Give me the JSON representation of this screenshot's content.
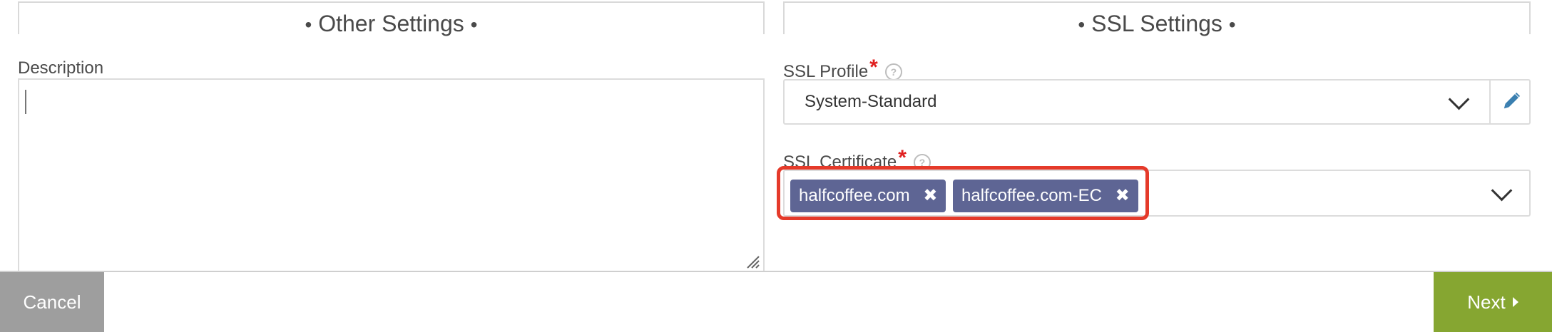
{
  "sections": {
    "other": {
      "title": "Other Settings",
      "bullet": "•"
    },
    "ssl": {
      "title": "SSL Settings",
      "bullet": "•"
    }
  },
  "description": {
    "label": "Description",
    "value": ""
  },
  "ssl_profile": {
    "label": "SSL Profile",
    "required_mark": "*",
    "help_glyph": "?",
    "value": "System-Standard"
  },
  "ssl_certificate": {
    "label": "SSL Certificate",
    "required_mark": "*",
    "help_glyph": "?",
    "tags": [
      {
        "label": "halfcoffee.com",
        "remove_glyph": "✖"
      },
      {
        "label": "halfcoffee.com-EC",
        "remove_glyph": "✖"
      }
    ]
  },
  "footer": {
    "cancel_label": "Cancel",
    "next_label": "Next"
  },
  "colors": {
    "tag_bg": "#5e6594",
    "next_bg": "#86a631",
    "cancel_bg": "#9e9e9e",
    "required": "#e02020",
    "highlight": "#e53a2a"
  }
}
